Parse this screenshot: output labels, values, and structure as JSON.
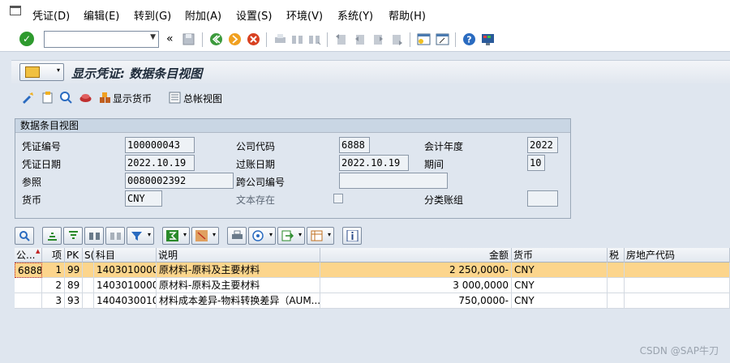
{
  "menubar": {
    "items": [
      "凭证(D)",
      "编辑(E)",
      "转到(G)",
      "附加(A)",
      "设置(S)",
      "环境(V)",
      "系统(Y)",
      "帮助(H)"
    ]
  },
  "systool": {
    "command_value": "",
    "back_glyph": "«"
  },
  "page": {
    "title": "显示凭证: 数据条目视图"
  },
  "apptool": {
    "display_currency": "显示货币",
    "general_ledger_view": "总帐视图"
  },
  "header": {
    "group_title": "数据条目视图",
    "doc_number_label": "凭证编号",
    "doc_number": "100000043",
    "company_code_label": "公司代码",
    "company_code": "6888",
    "fiscal_year_label": "会计年度",
    "fiscal_year": "2022",
    "doc_date_label": "凭证日期",
    "doc_date": "2022.10.19",
    "posting_date_label": "过账日期",
    "posting_date": "2022.10.19",
    "period_label": "期间",
    "period": "10",
    "reference_label": "参照",
    "reference": "0080002392",
    "cross_cc_label": "跨公司编号",
    "cross_cc": "",
    "currency_label": "货币",
    "currency": "CNY",
    "text_exists_label": "文本存在",
    "ledger_group_label": "分类账组",
    "ledger_group": ""
  },
  "grid": {
    "columns": [
      "公...",
      "项",
      "PK",
      "S(",
      "科目",
      "说明",
      "金额",
      "货币",
      "税",
      "房地产代码"
    ],
    "rows": [
      {
        "cc": "6888",
        "item": "1",
        "pk": "99",
        "s": "",
        "account": "1403010000",
        "desc": "原材料-原料及主要材料",
        "amount": "2 250,0000-",
        "currency": "CNY",
        "tax": "",
        "re": ""
      },
      {
        "cc": "",
        "item": "2",
        "pk": "89",
        "s": "",
        "account": "1403010000",
        "desc": "原材料-原料及主要材料",
        "amount": "3 000,0000",
        "currency": "CNY",
        "tax": "",
        "re": ""
      },
      {
        "cc": "",
        "item": "3",
        "pk": "93",
        "s": "",
        "account": "1404030010",
        "desc": "材料成本差异-物料转换差异（AUM...",
        "amount": "750,0000-",
        "currency": "CNY",
        "tax": "",
        "re": ""
      }
    ]
  },
  "watermark": "CSDN @SAP牛刀",
  "colors": {
    "selected_row": "#fcd58c",
    "background": "#dfe6ef",
    "title_text": "#1e2b3a"
  }
}
